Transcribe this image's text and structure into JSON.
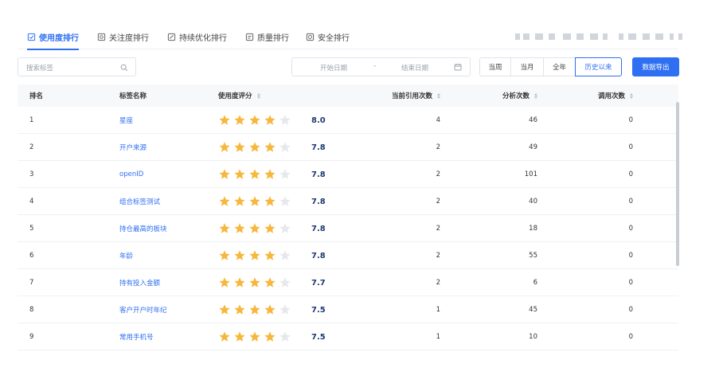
{
  "tabs": [
    {
      "label": "使用度排行",
      "icon": "usage-icon",
      "active": true
    },
    {
      "label": "关注度排行",
      "icon": "attention-icon",
      "active": false
    },
    {
      "label": "持续优化排行",
      "icon": "optimize-icon",
      "active": false
    },
    {
      "label": "质量排行",
      "icon": "quality-icon",
      "active": false
    },
    {
      "label": "安全排行",
      "icon": "security-icon",
      "active": false
    }
  ],
  "search": {
    "placeholder": "搜索标签"
  },
  "date_range": {
    "start_placeholder": "开始日期",
    "separator": "-",
    "end_placeholder": "结束日期"
  },
  "range_buttons": [
    {
      "label": "当周",
      "active": false
    },
    {
      "label": "当月",
      "active": false
    },
    {
      "label": "全年",
      "active": false
    },
    {
      "label": "历史以来",
      "active": true
    }
  ],
  "export_label": "数据导出",
  "columns": {
    "rank": "排名",
    "name": "标签名称",
    "score": "使用度评分",
    "refs": "当前引用次数",
    "analysis": "分析次数",
    "calls": "调用次数"
  },
  "rows": [
    {
      "rank": "1",
      "name": "星座",
      "stars": 4,
      "score": "8.0",
      "refs": "4",
      "analysis": "46",
      "calls": "0"
    },
    {
      "rank": "2",
      "name": "开户来源",
      "stars": 4,
      "score": "7.8",
      "refs": "2",
      "analysis": "49",
      "calls": "0"
    },
    {
      "rank": "3",
      "name": "openID",
      "stars": 4,
      "score": "7.8",
      "refs": "2",
      "analysis": "101",
      "calls": "0"
    },
    {
      "rank": "4",
      "name": "组合标签测试",
      "stars": 4,
      "score": "7.8",
      "refs": "2",
      "analysis": "40",
      "calls": "0"
    },
    {
      "rank": "5",
      "name": "持仓最高的板块",
      "stars": 4,
      "score": "7.8",
      "refs": "2",
      "analysis": "18",
      "calls": "0"
    },
    {
      "rank": "6",
      "name": "年龄",
      "stars": 4,
      "score": "7.8",
      "refs": "2",
      "analysis": "55",
      "calls": "0"
    },
    {
      "rank": "7",
      "name": "持有投入金额",
      "stars": 4,
      "score": "7.7",
      "refs": "2",
      "analysis": "6",
      "calls": "0"
    },
    {
      "rank": "8",
      "name": "客户开户时年纪",
      "stars": 4,
      "score": "7.5",
      "refs": "1",
      "analysis": "45",
      "calls": "0"
    },
    {
      "rank": "9",
      "name": "常用手机号",
      "stars": 4,
      "score": "7.5",
      "refs": "1",
      "analysis": "10",
      "calls": "0"
    }
  ],
  "colors": {
    "accent": "#2f6ff2",
    "star_filled": "#f6b73c",
    "star_empty": "#e6e8ec",
    "score_text": "#1f3a70"
  }
}
